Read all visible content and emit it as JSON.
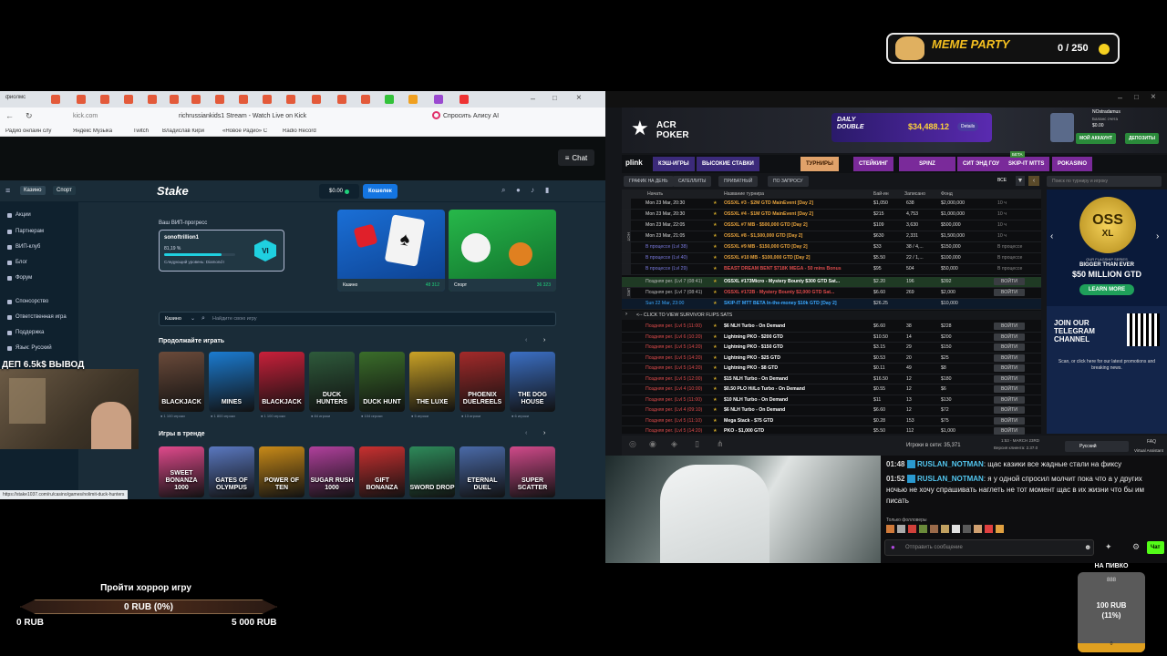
{
  "overlay": {
    "meme_party_title": "MEME PARTY",
    "meme_party_count": "0 / 250",
    "dep_text": "ДЕП 6.5k$  ВЫВОД",
    "horror_title": "Пройти хоррор игру",
    "horror_progress": "0 RUB (0%)",
    "horror_min": "0 RUB",
    "horror_max": "5 000 RUB",
    "beer_title": "НА ПИВКО",
    "beer_amount": "100 RUB",
    "beer_percent": "(11%)",
    "beer_top": "888",
    "beer_bottom": "0"
  },
  "browser": {
    "tab_label": "фиолмс",
    "url": "kick.com",
    "page_title": "richrussiankids1 Stream - Watch Live on Kick",
    "alice": "Спросить Алису AI",
    "bookmarks": [
      "Радио онлайн слу",
      "Яндекс Музыка",
      "Twitch",
      "Владислав Кири",
      "«Новое Радио» С",
      "Radio Record"
    ],
    "chat_button": "Chat",
    "status_url": "https://stake1037.com/ru/casino/games/nolimit-duck-hunters"
  },
  "stake": {
    "tab_casino": "Казино",
    "tab_sport": "Спорт",
    "logo": "Stake",
    "balance": "$0.00",
    "wallet_button": "Кошелек",
    "sidebar": [
      "Акции",
      "Партнерам",
      "ВИП-клуб",
      "Блог",
      "Форум",
      "Спонсорство",
      "Ответственная игра",
      "Поддержка",
      "Язык: Русский"
    ],
    "vip_title": "Ваш ВИП-прогресс",
    "vip_user": "sonoftrillion1",
    "vip_percent": "81,19 %",
    "vip_next": "Следующий уровень: Diamond I",
    "promo_casino": "Казино",
    "promo_casino_count": "48 312",
    "promo_sport": "Спорт",
    "promo_sport_count": "36 323",
    "search_select": "Казино",
    "search_placeholder": "Найдите свою игру",
    "continue_title": "Продолжайте играть",
    "trending_title": "Игры в тренде",
    "continue_games": [
      {
        "name": "BLACKJACK",
        "players": "● 1 100 игроки",
        "bg": "#6a4a3a"
      },
      {
        "name": "MINES",
        "players": "● 1 800 игроки",
        "bg": "#1b7bd0"
      },
      {
        "name": "BLACKJACK",
        "players": "● 1 100 игроки",
        "bg": "#c8203a"
      },
      {
        "name": "DUCK HUNTERS",
        "players": "● 84 игроки",
        "bg": "#2e5a3b"
      },
      {
        "name": "DUCK HUNT",
        "players": "● 104 игроки",
        "bg": "#3a6d2a"
      },
      {
        "name": "THE LUXE",
        "players": "● 5 игроки",
        "bg": "#caa226"
      },
      {
        "name": "PHOENIX DUELREELS",
        "players": "● 13 игроки",
        "bg": "#a32a2a"
      },
      {
        "name": "THE DOG HOUSE",
        "players": "● 6 игроки",
        "bg": "#3b6fc4"
      }
    ],
    "trending_games": [
      {
        "name": "SWEET BONANZA 1000",
        "bg": "#e04a8c"
      },
      {
        "name": "GATES OF OLYMPUS",
        "bg": "#5a78c0"
      },
      {
        "name": "POWER OF TEN",
        "bg": "#c88a18"
      },
      {
        "name": "SUGAR RUSH 1000",
        "bg": "#b0409c"
      },
      {
        "name": "GIFT BONANZA",
        "bg": "#c83030"
      },
      {
        "name": "SWORD DROP",
        "bg": "#2e8a5a"
      },
      {
        "name": "ETERNAL DUEL",
        "bg": "#4a6aa8"
      },
      {
        "name": "SUPER SCATTER",
        "bg": "#d04a8a"
      }
    ]
  },
  "poker": {
    "logo": "ACR POKER",
    "daily_double": "DAILY DOUBLE",
    "jackpot": "$34,488.12",
    "details": "Details",
    "username": "NOstradamus",
    "balance_label": "Баланс счета",
    "balance": "$0.00",
    "my_account": "МОЙ АККАУНТ",
    "deposit": "ДЕПОЗИТЫ",
    "plink": "plink",
    "nav": [
      "КЭШ-ИГРЫ",
      "ВЫСОКИЕ СТАВКИ",
      "ТУРНИРЫ",
      "СТЕЙКИНГ",
      "SPINZ",
      "СИТ ЭНД ГОУ",
      "SKIP-IT MTTS",
      "POKASINO"
    ],
    "nav_badge": "БЕТА",
    "sub": [
      "ГРАФИК НА ДЕНЬ",
      "САТЕЛЛИТЫ",
      "ПРИВАТНЫЙ",
      "ПО ЗАПРОСУ"
    ],
    "all_label": "ВСЕ",
    "search_placeholder": "Поиск по турниру и игроку",
    "headers": [
      "Начать",
      "Название турнира",
      "Бай-ин",
      "Записано",
      "Фонд"
    ],
    "rows": [
      {
        "start": "Mon 23 Mar, 20:30",
        "name": "OSSXL #3 - $2M GTD MainEvent [Day 2]",
        "buyin": "$1,050",
        "reg": "638",
        "prize": "$2,000,000",
        "color": "#e6a23c",
        "status": "10 ч"
      },
      {
        "start": "Mon 23 Mar, 20:30",
        "name": "OSSXL #4 - $1M GTD MainEvent [Day 2]",
        "buyin": "$215",
        "reg": "4,753",
        "prize": "$1,000,000",
        "color": "#e6a23c",
        "status": "10 ч"
      },
      {
        "start": "Mon 23 Mar, 22:05",
        "name": "OSSXL #7 MB - $500,000 GTD [Day 2]",
        "buyin": "$109",
        "reg": "3,630",
        "prize": "$500,000",
        "color": "#e6a23c",
        "status": "10 ч"
      },
      {
        "start": "Mon 23 Mar, 21:05",
        "name": "OSSXL #8 - $1,500,000 GTD [Day 2]",
        "buyin": "$630",
        "reg": "2,331",
        "prize": "$1,500,000",
        "color": "#e6a23c",
        "status": "10 ч"
      },
      {
        "start": "В процессе (Lvl 38)",
        "name": "OSSXL #9 MB - $150,000 GTD [Day 2]",
        "buyin": "$33",
        "reg": "38 / 4,...",
        "prize": "$150,000",
        "color": "#e6a23c",
        "status": "В процессе"
      },
      {
        "start": "В процессе (Lvl 40)",
        "name": "OSSXL #10 MB - $100,000 GTD [Day 2]",
        "buyin": "$5.50",
        "reg": "22 / 1,...",
        "prize": "$100,000",
        "color": "#e6a23c",
        "status": "В процессе"
      },
      {
        "start": "В процессе (Lvl 29)",
        "name": "BEAST DREAM BENT $718K MEGA - 50 mins Bonus",
        "buyin": "$95",
        "reg": "504",
        "prize": "$50,000",
        "color": "#d94b4b",
        "status": "В процессе"
      }
    ],
    "skip_rows": [
      {
        "start": "Поздняя рег. (Lvl 7 (08:41)",
        "name": "OSSXL #173Micro - Mystery Bounty $300 GTD Sat...",
        "buyin": "$2.20",
        "reg": "196",
        "prize": "$392",
        "action": "ВОЙТИ"
      },
      {
        "start": "Поздняя рег. (Lvl 7 (08:41)",
        "name": "OSSXL #172B - Mystery Bounty $2,000 GTD Sat...",
        "buyin": "$6.60",
        "reg": "269",
        "prize": "$2,000",
        "action": "ВОЙТИ"
      },
      {
        "start": "Sun  22 Mar, 23:00",
        "name": "SKIP-IT MTT BETA In-the-money $10k GTD [Day 2]",
        "buyin": "$26.25",
        "reg": "",
        "prize": "$10,000",
        "action": ""
      }
    ],
    "click_to_view": "<-- CLICK TO VIEW SURVIVOR FLIPS SATS",
    "sat_rows": [
      {
        "start": "Поздняя рег. (Lvl 5 (11:00)",
        "name": "$6 NLH Turbo - On Demand",
        "buyin": "$6.60",
        "reg": "38",
        "prize": "$228"
      },
      {
        "start": "Поздняя рег. (Lvl 6 (10:20)",
        "name": "Lightning PKO - $200 GTD",
        "buyin": "$10.50",
        "reg": "14",
        "prize": "$200"
      },
      {
        "start": "Поздняя рег. (Lvl 5 (14:20)",
        "name": "Lightning PKO - $150 GTD",
        "buyin": "$3.15",
        "reg": "29",
        "prize": "$150"
      },
      {
        "start": "Поздняя рег. (Lvl 5 (14:20)",
        "name": "Lightning PKO - $25 GTD",
        "buyin": "$0.53",
        "reg": "20",
        "prize": "$25"
      },
      {
        "start": "Поздняя рег. (Lvl 5 (14:20)",
        "name": "Lightning PKO - $8 GTD",
        "buyin": "$0.11",
        "reg": "49",
        "prize": "$8"
      },
      {
        "start": "Поздняя рег. (Lvl 5 (12:00)",
        "name": "$15 NLH Turbo - On Demand",
        "buyin": "$16.50",
        "reg": "12",
        "prize": "$180"
      },
      {
        "start": "Поздняя рег. (Lvl 4 (10:00)",
        "name": "$0.50 PLO Hi/Lo Turbo - On Demand",
        "buyin": "$0.55",
        "reg": "12",
        "prize": "$6"
      },
      {
        "start": "Поздняя рег. (Lvl 5 (11:00)",
        "name": "$10 NLH Turbo - On Demand",
        "buyin": "$11",
        "reg": "13",
        "prize": "$130"
      },
      {
        "start": "Поздняя рег. (Lvl 4 (09:10)",
        "name": "$6 NLH Turbo - On Demand",
        "buyin": "$6.60",
        "reg": "12",
        "prize": "$72"
      },
      {
        "start": "Поздняя рег. (Lvl 5 (11:10)",
        "name": "Mega Stack - $75 GTD",
        "buyin": "$0.28",
        "reg": "153",
        "prize": "$75"
      },
      {
        "start": "Поздняя рег. (Lvl 5 (14:20)",
        "name": "PKO - $1,000 GTD",
        "buyin": "$5.50",
        "reg": "112",
        "prize": "$1,000"
      }
    ],
    "join": "ВОЙТИ",
    "ad_oss": "OSS",
    "ad_xl": "XL",
    "ad_sub": "OUR FLAGSHIP SERIES",
    "ad_bigger": "BIGGER THAN EVER",
    "ad_gtd": "$50 MILLION GTD",
    "ad_learn": "LEARN MORE",
    "tg_join": "JOIN OUR TELEGRAM CHANNEL",
    "tg_desc": "Scan, or click here for our latest promotions and breaking news.",
    "online": "Игроки в сети: 35,371",
    "time": "1:53 - MARCH 23RD",
    "version": "Версия клиента: 2.37.0",
    "language": "Русский",
    "faq": "FAQ",
    "assistant": "Virtual Assistant"
  },
  "chat": {
    "messages": [
      {
        "time": "01:48",
        "user": "RUSLAN_NOTMAN",
        "text": "щас казики все жадные стали на фиксу"
      },
      {
        "time": "01:52",
        "user": "RUSLAN_NOTMAN",
        "text": "я у одной спросил молчит пока что а у других ночью не хочу спрашивать наглеть не тот момент щас в их жизни что бы им писать"
      }
    ],
    "followers_only": "Только фолловеры",
    "input_placeholder": "Отправить сообщение",
    "send": "Чат"
  }
}
